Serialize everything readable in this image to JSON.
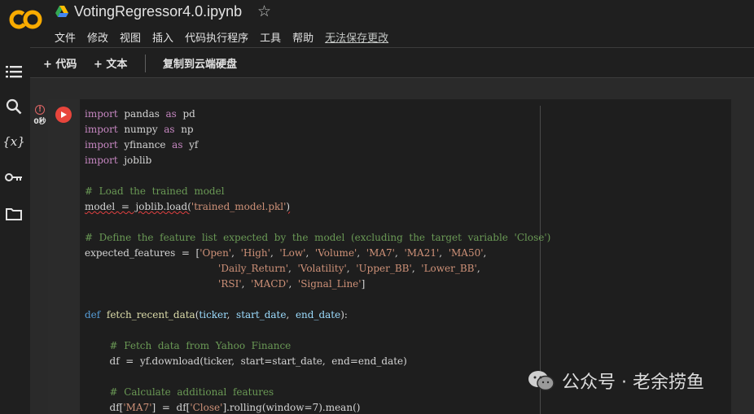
{
  "app": {
    "logo_text": "CO",
    "notebook_title": "VotingRegressor4.0.ipynb"
  },
  "menu": {
    "items": [
      "文件",
      "修改",
      "视图",
      "插入",
      "代码执行程序",
      "工具",
      "帮助"
    ],
    "save_note": "无法保存更改"
  },
  "toolbar": {
    "add_code": "+ 代码",
    "add_text": "+ 文本",
    "copy_to_drive": "复制到云端硬盘"
  },
  "sidebar": {
    "icons": [
      "table-of-contents-icon",
      "search-icon",
      "variables-icon",
      "secrets-key-icon",
      "files-folder-icon"
    ],
    "variables_glyph": "{x}"
  },
  "cell": {
    "status_time": "0秒",
    "status_error_glyph": "!",
    "lines": [
      [
        [
          "kw",
          "import"
        ],
        [
          "",
          "  pandas  "
        ],
        [
          "kw",
          "as"
        ],
        [
          "",
          "  pd"
        ]
      ],
      [
        [
          "kw",
          "import"
        ],
        [
          "",
          "  numpy  "
        ],
        [
          "kw",
          "as"
        ],
        [
          "",
          "  np"
        ]
      ],
      [
        [
          "kw",
          "import"
        ],
        [
          "",
          "  yfinance  "
        ],
        [
          "kw",
          "as"
        ],
        [
          "",
          "  yf"
        ]
      ],
      [
        [
          "kw",
          "import"
        ],
        [
          "",
          "  joblib"
        ]
      ],
      [],
      [
        [
          "cm",
          "#  Load  the  trained  model"
        ]
      ],
      [
        [
          "sq",
          "model  =  joblib.load("
        ],
        [
          "st",
          "'trained_model.pkl'"
        ],
        [
          "sq",
          ")"
        ]
      ],
      [],
      [
        [
          "cm",
          "#  Define  the  feature  list  expected  by  the  model  (excluding  the  target  variable  'Close')"
        ]
      ],
      [
        [
          "",
          "expected_features  =  ["
        ],
        [
          "st",
          "'Open'"
        ],
        [
          "",
          ",  "
        ],
        [
          "st",
          "'High'"
        ],
        [
          "",
          ",  "
        ],
        [
          "st",
          "'Low'"
        ],
        [
          "",
          ",  "
        ],
        [
          "st",
          "'Volume'"
        ],
        [
          "",
          ",  "
        ],
        [
          "st",
          "'MA7'"
        ],
        [
          "",
          ",  "
        ],
        [
          "st",
          "'MA21'"
        ],
        [
          "",
          ",  "
        ],
        [
          "st",
          "'MA50'"
        ],
        [
          "",
          ","
        ]
      ],
      [
        [
          "",
          "                                           "
        ],
        [
          "st",
          "'Daily_Return'"
        ],
        [
          "",
          ",  "
        ],
        [
          "st",
          "'Volatility'"
        ],
        [
          "",
          ",  "
        ],
        [
          "st",
          "'Upper_BB'"
        ],
        [
          "",
          ",  "
        ],
        [
          "st",
          "'Lower_BB'"
        ],
        [
          "",
          ","
        ]
      ],
      [
        [
          "",
          "                                           "
        ],
        [
          "st",
          "'RSI'"
        ],
        [
          "",
          ",  "
        ],
        [
          "st",
          "'MACD'"
        ],
        [
          "",
          ",  "
        ],
        [
          "st",
          "'Signal_Line'"
        ],
        [
          "",
          "]"
        ]
      ],
      [],
      [
        [
          "kd",
          "def"
        ],
        [
          "",
          "  "
        ],
        [
          "fn",
          "fetch_recent_data"
        ],
        [
          "",
          "("
        ],
        [
          "pr",
          "ticker"
        ],
        [
          "",
          ",  "
        ],
        [
          "pr",
          "start_date"
        ],
        [
          "",
          ",  "
        ],
        [
          "pr",
          "end_date"
        ],
        [
          "",
          "):"
        ]
      ],
      [],
      [
        [
          "",
          "        "
        ],
        [
          "cm",
          "#  Fetch  data  from  Yahoo  Finance"
        ]
      ],
      [
        [
          "",
          "        df  =  yf.download(ticker,  start=start_date,  end=end_date)"
        ]
      ],
      [],
      [
        [
          "",
          "        "
        ],
        [
          "cm",
          "#  Calculate  additional  features"
        ]
      ],
      [
        [
          "",
          "        df["
        ],
        [
          "st",
          "'MA7'"
        ],
        [
          "",
          "]  =  df["
        ],
        [
          "st",
          "'Close'"
        ],
        [
          "",
          "].rolling(window=7).mean()"
        ]
      ]
    ]
  },
  "watermark": {
    "text": "公众号 · 老余捞鱼"
  }
}
